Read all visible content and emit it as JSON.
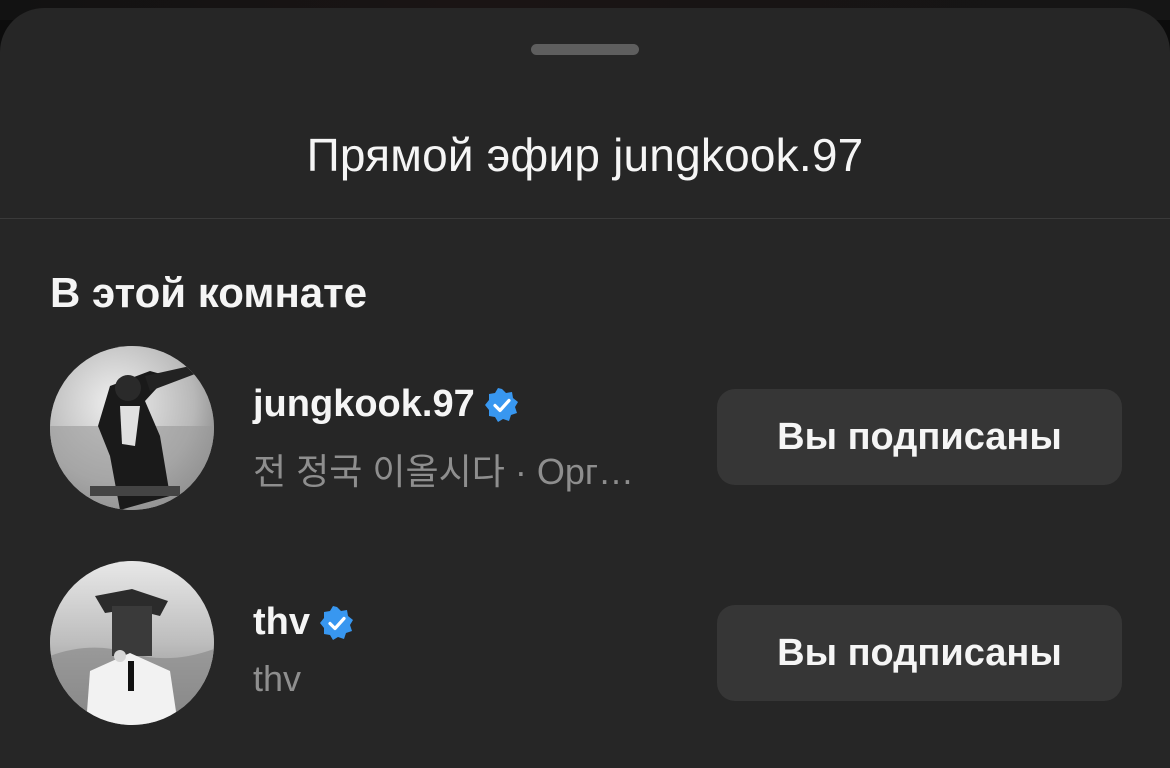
{
  "sheet": {
    "title": "Прямой эфир jungkook.97",
    "section_heading": "В этой комнате"
  },
  "participants": [
    {
      "username": "jungkook.97",
      "verified": true,
      "subtitle": "전 정국 이올시다 · Орг…",
      "follow_label": "Вы подписаны"
    },
    {
      "username": "thv",
      "verified": true,
      "subtitle": "thv",
      "follow_label": "Вы подписаны"
    }
  ],
  "colors": {
    "sheet_background": "#262626",
    "button_background": "#363636",
    "verified_badge": "#3897f0",
    "secondary_text": "#8e8e8e"
  }
}
